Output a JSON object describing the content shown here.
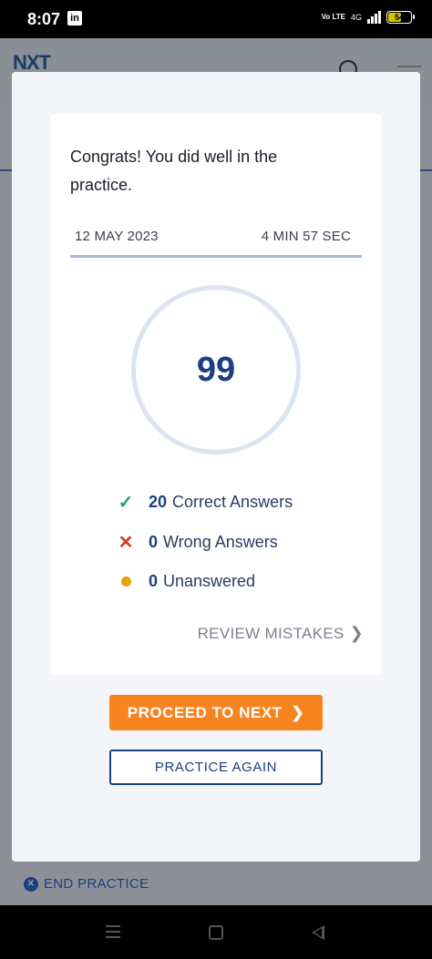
{
  "status_bar": {
    "time": "8:07",
    "linkedin_glyph": "in",
    "network": "4G",
    "volte": "Vo LTE",
    "battery": "54"
  },
  "background_app": {
    "logo": "NXT",
    "end_practice_label": "END PRACTICE"
  },
  "result": {
    "congrats_message": "Congrats! You did well in the practice.",
    "date": "12 MAY 2023",
    "duration": "4 MIN 57 SEC",
    "score": "99",
    "stats": [
      {
        "count": "20",
        "label": "Correct Answers",
        "icon": "check-icon",
        "color": "#21a36a"
      },
      {
        "count": "0",
        "label": "Wrong Answers",
        "icon": "cross-icon",
        "color": "#d93b2b"
      },
      {
        "count": "0",
        "label": "Unanswered",
        "icon": "dot-icon",
        "color": "#e6a400"
      }
    ],
    "review_label": "REVIEW MISTAKES"
  },
  "actions": {
    "proceed_label": "PROCEED TO NEXT",
    "practice_again_label": "PRACTICE AGAIN"
  },
  "colors": {
    "accent": "#f7841f",
    "brand": "#1b3f80"
  }
}
